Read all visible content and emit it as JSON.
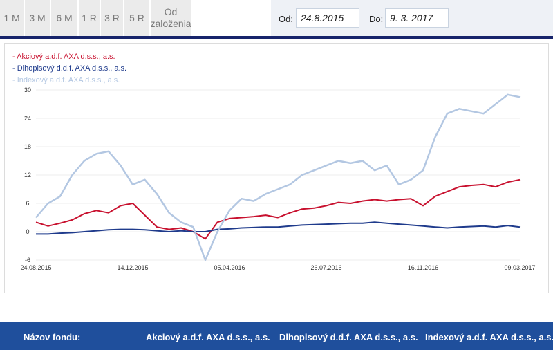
{
  "range_buttons": [
    "1 M",
    "3 M",
    "6 M",
    "1 R",
    "3 R",
    "5 R",
    "Od založenia"
  ],
  "date_filter": {
    "from_label": "Od:",
    "from_value": "24.8.2015",
    "to_label": "Do:",
    "to_value": "9. 3. 2017"
  },
  "colors": {
    "akciovy": "#c8102e",
    "dlhopisovy": "#1f3b8c",
    "indexovy": "#b3c7e2",
    "navy": "#17246b",
    "footer": "#1f4f9c"
  },
  "chart_data": {
    "type": "line",
    "title": "",
    "xlabel": "",
    "ylabel": "",
    "ylim": [
      -6,
      30
    ],
    "yticks": [
      -6,
      0,
      6,
      12,
      18,
      24,
      30
    ],
    "xtick_labels": [
      "24.08.2015",
      "14.12.2015",
      "05.04.2016",
      "26.07.2016",
      "16.11.2016",
      "09.03.2017"
    ],
    "x": [
      "24.08.2015",
      "07.09.2015",
      "21.09.2015",
      "05.10.2015",
      "19.10.2015",
      "02.11.2015",
      "16.11.2015",
      "30.11.2015",
      "14.12.2015",
      "28.12.2015",
      "11.01.2016",
      "25.01.2016",
      "08.02.2016",
      "22.02.2016",
      "07.03.2016",
      "21.03.2016",
      "05.04.2016",
      "19.04.2016",
      "03.05.2016",
      "17.05.2016",
      "31.05.2016",
      "14.06.2016",
      "28.06.2016",
      "12.07.2016",
      "26.07.2016",
      "09.08.2016",
      "23.08.2016",
      "06.09.2016",
      "20.09.2016",
      "04.10.2016",
      "18.10.2016",
      "02.11.2016",
      "16.11.2016",
      "30.11.2016",
      "14.12.2016",
      "28.12.2016",
      "11.01.2017",
      "25.01.2017",
      "08.02.2017",
      "22.02.2017",
      "09.03.2017"
    ],
    "legend_position": "top-left",
    "grid": true,
    "series": [
      {
        "name": "Akciový a.d.f. AXA d.s.s., a.s.",
        "color": "#c8102e",
        "values": [
          2.0,
          1.2,
          1.8,
          2.5,
          3.8,
          4.5,
          4.0,
          5.5,
          6.0,
          3.5,
          1.0,
          0.5,
          0.8,
          0.0,
          -1.5,
          2.0,
          2.8,
          3.0,
          3.2,
          3.5,
          3.0,
          4.0,
          4.8,
          5.0,
          5.5,
          6.2,
          6.0,
          6.5,
          6.8,
          6.5,
          6.8,
          7.0,
          5.5,
          7.5,
          8.5,
          9.5,
          9.8,
          10.0,
          9.5,
          10.5,
          11.0
        ]
      },
      {
        "name": "Dlhopisový d.d.f. AXA d.s.s., a.s.",
        "color": "#1f3b8c",
        "values": [
          -0.5,
          -0.5,
          -0.3,
          -0.2,
          0.0,
          0.2,
          0.4,
          0.5,
          0.5,
          0.4,
          0.2,
          0.0,
          0.2,
          0.0,
          0.0,
          0.5,
          0.6,
          0.8,
          0.9,
          1.0,
          1.0,
          1.2,
          1.4,
          1.5,
          1.6,
          1.7,
          1.8,
          1.8,
          2.0,
          1.8,
          1.6,
          1.4,
          1.2,
          1.0,
          0.8,
          1.0,
          1.1,
          1.2,
          1.0,
          1.3,
          1.0
        ]
      },
      {
        "name": "Indexový a.d.f. AXA d.s.s., a.s.",
        "color": "#b3c7e2",
        "values": [
          3.0,
          6.0,
          7.5,
          12.0,
          15.0,
          16.5,
          17.0,
          14.0,
          10.0,
          11.0,
          8.0,
          4.0,
          2.0,
          1.0,
          -6.0,
          0.0,
          4.5,
          7.0,
          6.5,
          8.0,
          9.0,
          10.0,
          12.0,
          13.0,
          14.0,
          15.0,
          14.5,
          15.0,
          13.0,
          14.0,
          10.0,
          11.0,
          13.0,
          20.0,
          25.0,
          26.0,
          25.5,
          25.0,
          27.0,
          29.0,
          28.5
        ]
      }
    ]
  },
  "footer": {
    "label": "Názov fondu:",
    "fund1": "Akciový a.d.f. AXA d.s.s., a.s.",
    "fund2": "Dlhopisový d.d.f. AXA d.s.s., a.s.",
    "fund3": "Indexový a.d.f. AXA d.s.s., a.s."
  }
}
